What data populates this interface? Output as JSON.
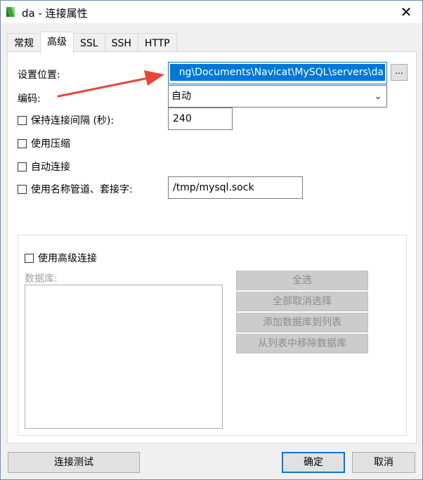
{
  "window": {
    "title": "da - 连接属性",
    "close_glyph": "✕"
  },
  "tabs": [
    {
      "label": "常规"
    },
    {
      "label": "高级"
    },
    {
      "label": "SSL"
    },
    {
      "label": "SSH"
    },
    {
      "label": "HTTP"
    }
  ],
  "settings": {
    "location_label": "设置位置:",
    "location_value": "ng\\Documents\\Navicat\\MySQL\\servers\\da",
    "browse_label": "...",
    "encoding_label": "编码:",
    "encoding_value": "自动",
    "keepalive_label": "保持连接间隔 (秒):",
    "keepalive_value": "240",
    "compression_label": "使用压缩",
    "autoconnect_label": "自动连接",
    "named_pipe_label": "使用名称管道、套接字:",
    "named_pipe_value": "/tmp/mysql.sock"
  },
  "advanced": {
    "checkbox_label": "使用高级连接",
    "database_label": "数据库:",
    "buttons": {
      "select_all": "全选",
      "deselect_all": "全部取消选择",
      "add_to_list": "添加数据库到列表",
      "remove_from_list": "从列表中移除数据库"
    }
  },
  "footer": {
    "test_label": "连接测试",
    "ok_label": "确定",
    "cancel_label": "取消"
  },
  "colors": {
    "selection": "#0078d7",
    "annotation_arrow": "#e8463a"
  }
}
